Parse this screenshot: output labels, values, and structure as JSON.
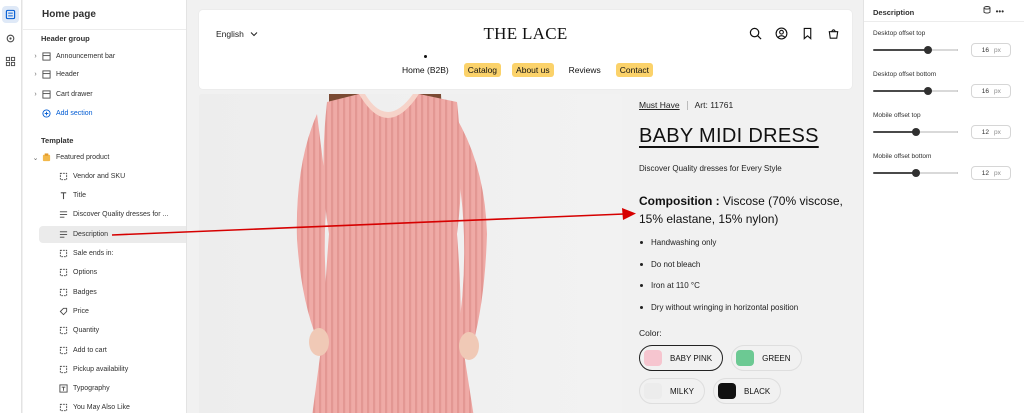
{
  "left_panel": {
    "title": "Home page",
    "header_group_label": "Header group",
    "header_items": [
      "Announcement bar",
      "Header",
      "Cart drawer"
    ],
    "add_section_label": "Add section",
    "template_label": "Template",
    "featured_product_label": "Featured product",
    "blocks": [
      "Vendor and SKU",
      "Title",
      "Discover Quality dresses for ...",
      "Description",
      "Sale ends in:",
      "Options",
      "Badges",
      "Price",
      "Quantity",
      "Add to cart",
      "Pickup availability",
      "Typography",
      "You May Also Like"
    ]
  },
  "store": {
    "language": "English",
    "logo": "THE LACE",
    "nav": [
      "Home (B2B)",
      "Catalog",
      "About us",
      "Reviews",
      "Contact"
    ],
    "nav_highlight_color": "#fbd26a"
  },
  "product": {
    "vendor_link": "Must Have",
    "sku": "Art: 11761",
    "title": "BABY MIDI DRESS",
    "tagline": "Discover Quality dresses for Every Style",
    "composition_label": "Composition :",
    "composition_text": " Viscose (70% viscose, 15% elastane, 15% nylon)",
    "care": [
      "Handwashing only",
      "Do not bleach",
      "Iron at 110 °C",
      "Dry without wringing in horizontal position"
    ],
    "color_label": "Color:",
    "colors": [
      {
        "name": "BABY PINK",
        "hex": "#f6c5cf",
        "selected": true
      },
      {
        "name": "GREEN",
        "hex": "#6cc993",
        "selected": false
      },
      {
        "name": "MILKY",
        "hex": "#ececec",
        "selected": false
      },
      {
        "name": "BLACK",
        "hex": "#111111",
        "selected": false
      }
    ]
  },
  "right_panel": {
    "title": "Description",
    "settings": [
      {
        "label": "Desktop offset top",
        "value": "16",
        "unit": "px",
        "level": 0.65
      },
      {
        "label": "Desktop offset bottom",
        "value": "16",
        "unit": "px",
        "level": 0.65
      },
      {
        "label": "Mobile offset top",
        "value": "12",
        "unit": "px",
        "level": 0.5
      },
      {
        "label": "Mobile offset bottom",
        "value": "12",
        "unit": "px",
        "level": 0.5
      }
    ]
  },
  "annotation_color": "#d60000"
}
